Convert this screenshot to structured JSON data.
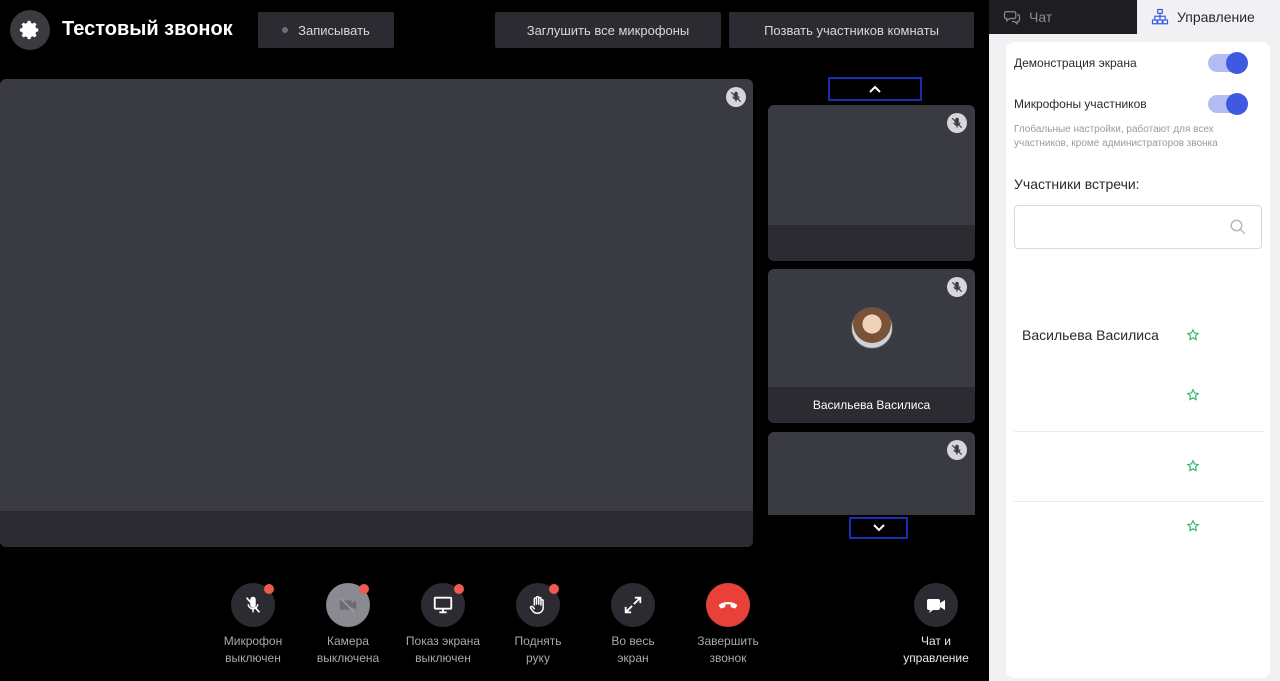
{
  "header": {
    "title": "Тестовый звонок",
    "record_label": "Записывать",
    "mute_all_label": "Заглушить все микрофоны",
    "invite_label": "Позвать участников комнаты",
    "settings_icon": "gear-icon"
  },
  "stage": {
    "tiles": [
      {
        "name": ""
      },
      {
        "name": "Васильева Василиса"
      },
      {
        "name": ""
      }
    ]
  },
  "controls": [
    {
      "label": "Микрофон\nвыключен",
      "icon": "mic-off-icon",
      "badge": true
    },
    {
      "label": "Камера\nвыключена",
      "icon": "camera-off-icon",
      "badge": true
    },
    {
      "label": "Показ экрана\nвыключен",
      "icon": "screen-share-icon",
      "badge": true
    },
    {
      "label": "Поднять\nруку",
      "icon": "hand-icon",
      "badge": true
    },
    {
      "label": "Во весь\nэкран",
      "icon": "fullscreen-icon",
      "badge": false
    },
    {
      "label": "Завершить\nзвонок",
      "icon": "hangup-icon",
      "badge": false
    },
    {
      "label": "Чат и\nуправление",
      "icon": "chat-video-icon",
      "badge": false
    }
  ],
  "panel": {
    "tabs": [
      {
        "label": "Чат",
        "icon": "chat-icon",
        "active": false
      },
      {
        "label": "Управление",
        "icon": "hierarchy-icon",
        "active": true
      }
    ],
    "screen_share_label": "Демонстрация экрана",
    "screen_share_on": true,
    "participant_mics_label": "Микрофоны участников",
    "participant_mics_on": true,
    "hint": "Глобальные настройки, работают для всех участников, кроме администраторов звонка",
    "members_title": "Участники встречи:",
    "search_placeholder": "",
    "members": [
      {
        "name": "Васильева Василиса"
      },
      {
        "name": ""
      },
      {
        "name": ""
      },
      {
        "name": ""
      }
    ]
  },
  "colors": {
    "accent": "#3f5ae0",
    "hangup": "#e8413a",
    "badge": "#ef5a50",
    "star": "#2fb86a"
  }
}
